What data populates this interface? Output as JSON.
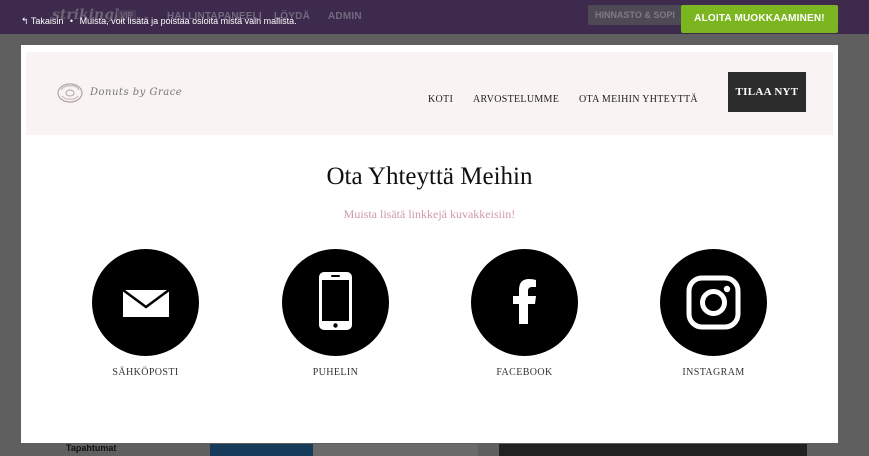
{
  "app": {
    "brand": "strikingly",
    "vip": "VIP",
    "nav": [
      "HALLINTAPANEELI",
      "LÖYDÄ",
      "ADMIN"
    ],
    "pricing": "HINNASTO & SOPI",
    "sidebar_label": "Tapahtumat"
  },
  "notice": {
    "back_label": "Takaisin",
    "separator": "•",
    "text": "Muista, voit lisätä ja poistaa osioita mistä vain mallista."
  },
  "cta": {
    "label": "ALOITA MUOKKAAMINEN!"
  },
  "site": {
    "logo_text": "Donuts by Grace",
    "menu": [
      "KOTI",
      "ARVOSTELUMME",
      "OTA MEIHIN YHTEYTTÄ"
    ],
    "order_button": "TILAA NYT"
  },
  "section": {
    "title": "Ota Yhteyttä Meihin",
    "subtitle": "Muista lisätä linkkejä kuvakkeisiin!",
    "contacts": [
      {
        "label": "SÄHKÖPOSTI",
        "icon": "envelope-icon"
      },
      {
        "label": "PUHELIN",
        "icon": "phone-icon"
      },
      {
        "label": "FACEBOOK",
        "icon": "facebook-icon"
      },
      {
        "label": "INSTAGRAM",
        "icon": "instagram-icon"
      }
    ]
  },
  "colors": {
    "cta_green": "#7bb51f",
    "topbar_purple": "#3d2a4d",
    "header_bg": "#f9f3f3",
    "subtitle_pink": "#cf9aa7"
  }
}
